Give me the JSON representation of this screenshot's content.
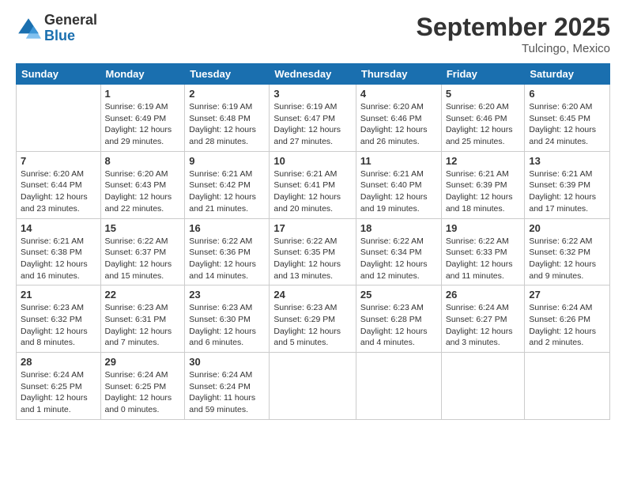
{
  "logo": {
    "general": "General",
    "blue": "Blue"
  },
  "title": "September 2025",
  "location": "Tulcingo, Mexico",
  "days_of_week": [
    "Sunday",
    "Monday",
    "Tuesday",
    "Wednesday",
    "Thursday",
    "Friday",
    "Saturday"
  ],
  "weeks": [
    [
      {
        "day": "",
        "sunrise": "",
        "sunset": "",
        "daylight": ""
      },
      {
        "day": "1",
        "sunrise": "Sunrise: 6:19 AM",
        "sunset": "Sunset: 6:49 PM",
        "daylight": "Daylight: 12 hours and 29 minutes."
      },
      {
        "day": "2",
        "sunrise": "Sunrise: 6:19 AM",
        "sunset": "Sunset: 6:48 PM",
        "daylight": "Daylight: 12 hours and 28 minutes."
      },
      {
        "day": "3",
        "sunrise": "Sunrise: 6:19 AM",
        "sunset": "Sunset: 6:47 PM",
        "daylight": "Daylight: 12 hours and 27 minutes."
      },
      {
        "day": "4",
        "sunrise": "Sunrise: 6:20 AM",
        "sunset": "Sunset: 6:46 PM",
        "daylight": "Daylight: 12 hours and 26 minutes."
      },
      {
        "day": "5",
        "sunrise": "Sunrise: 6:20 AM",
        "sunset": "Sunset: 6:46 PM",
        "daylight": "Daylight: 12 hours and 25 minutes."
      },
      {
        "day": "6",
        "sunrise": "Sunrise: 6:20 AM",
        "sunset": "Sunset: 6:45 PM",
        "daylight": "Daylight: 12 hours and 24 minutes."
      }
    ],
    [
      {
        "day": "7",
        "sunrise": "Sunrise: 6:20 AM",
        "sunset": "Sunset: 6:44 PM",
        "daylight": "Daylight: 12 hours and 23 minutes."
      },
      {
        "day": "8",
        "sunrise": "Sunrise: 6:20 AM",
        "sunset": "Sunset: 6:43 PM",
        "daylight": "Daylight: 12 hours and 22 minutes."
      },
      {
        "day": "9",
        "sunrise": "Sunrise: 6:21 AM",
        "sunset": "Sunset: 6:42 PM",
        "daylight": "Daylight: 12 hours and 21 minutes."
      },
      {
        "day": "10",
        "sunrise": "Sunrise: 6:21 AM",
        "sunset": "Sunset: 6:41 PM",
        "daylight": "Daylight: 12 hours and 20 minutes."
      },
      {
        "day": "11",
        "sunrise": "Sunrise: 6:21 AM",
        "sunset": "Sunset: 6:40 PM",
        "daylight": "Daylight: 12 hours and 19 minutes."
      },
      {
        "day": "12",
        "sunrise": "Sunrise: 6:21 AM",
        "sunset": "Sunset: 6:39 PM",
        "daylight": "Daylight: 12 hours and 18 minutes."
      },
      {
        "day": "13",
        "sunrise": "Sunrise: 6:21 AM",
        "sunset": "Sunset: 6:39 PM",
        "daylight": "Daylight: 12 hours and 17 minutes."
      }
    ],
    [
      {
        "day": "14",
        "sunrise": "Sunrise: 6:21 AM",
        "sunset": "Sunset: 6:38 PM",
        "daylight": "Daylight: 12 hours and 16 minutes."
      },
      {
        "day": "15",
        "sunrise": "Sunrise: 6:22 AM",
        "sunset": "Sunset: 6:37 PM",
        "daylight": "Daylight: 12 hours and 15 minutes."
      },
      {
        "day": "16",
        "sunrise": "Sunrise: 6:22 AM",
        "sunset": "Sunset: 6:36 PM",
        "daylight": "Daylight: 12 hours and 14 minutes."
      },
      {
        "day": "17",
        "sunrise": "Sunrise: 6:22 AM",
        "sunset": "Sunset: 6:35 PM",
        "daylight": "Daylight: 12 hours and 13 minutes."
      },
      {
        "day": "18",
        "sunrise": "Sunrise: 6:22 AM",
        "sunset": "Sunset: 6:34 PM",
        "daylight": "Daylight: 12 hours and 12 minutes."
      },
      {
        "day": "19",
        "sunrise": "Sunrise: 6:22 AM",
        "sunset": "Sunset: 6:33 PM",
        "daylight": "Daylight: 12 hours and 11 minutes."
      },
      {
        "day": "20",
        "sunrise": "Sunrise: 6:22 AM",
        "sunset": "Sunset: 6:32 PM",
        "daylight": "Daylight: 12 hours and 9 minutes."
      }
    ],
    [
      {
        "day": "21",
        "sunrise": "Sunrise: 6:23 AM",
        "sunset": "Sunset: 6:32 PM",
        "daylight": "Daylight: 12 hours and 8 minutes."
      },
      {
        "day": "22",
        "sunrise": "Sunrise: 6:23 AM",
        "sunset": "Sunset: 6:31 PM",
        "daylight": "Daylight: 12 hours and 7 minutes."
      },
      {
        "day": "23",
        "sunrise": "Sunrise: 6:23 AM",
        "sunset": "Sunset: 6:30 PM",
        "daylight": "Daylight: 12 hours and 6 minutes."
      },
      {
        "day": "24",
        "sunrise": "Sunrise: 6:23 AM",
        "sunset": "Sunset: 6:29 PM",
        "daylight": "Daylight: 12 hours and 5 minutes."
      },
      {
        "day": "25",
        "sunrise": "Sunrise: 6:23 AM",
        "sunset": "Sunset: 6:28 PM",
        "daylight": "Daylight: 12 hours and 4 minutes."
      },
      {
        "day": "26",
        "sunrise": "Sunrise: 6:24 AM",
        "sunset": "Sunset: 6:27 PM",
        "daylight": "Daylight: 12 hours and 3 minutes."
      },
      {
        "day": "27",
        "sunrise": "Sunrise: 6:24 AM",
        "sunset": "Sunset: 6:26 PM",
        "daylight": "Daylight: 12 hours and 2 minutes."
      }
    ],
    [
      {
        "day": "28",
        "sunrise": "Sunrise: 6:24 AM",
        "sunset": "Sunset: 6:25 PM",
        "daylight": "Daylight: 12 hours and 1 minute."
      },
      {
        "day": "29",
        "sunrise": "Sunrise: 6:24 AM",
        "sunset": "Sunset: 6:25 PM",
        "daylight": "Daylight: 12 hours and 0 minutes."
      },
      {
        "day": "30",
        "sunrise": "Sunrise: 6:24 AM",
        "sunset": "Sunset: 6:24 PM",
        "daylight": "Daylight: 11 hours and 59 minutes."
      },
      {
        "day": "",
        "sunrise": "",
        "sunset": "",
        "daylight": ""
      },
      {
        "day": "",
        "sunrise": "",
        "sunset": "",
        "daylight": ""
      },
      {
        "day": "",
        "sunrise": "",
        "sunset": "",
        "daylight": ""
      },
      {
        "day": "",
        "sunrise": "",
        "sunset": "",
        "daylight": ""
      }
    ]
  ]
}
